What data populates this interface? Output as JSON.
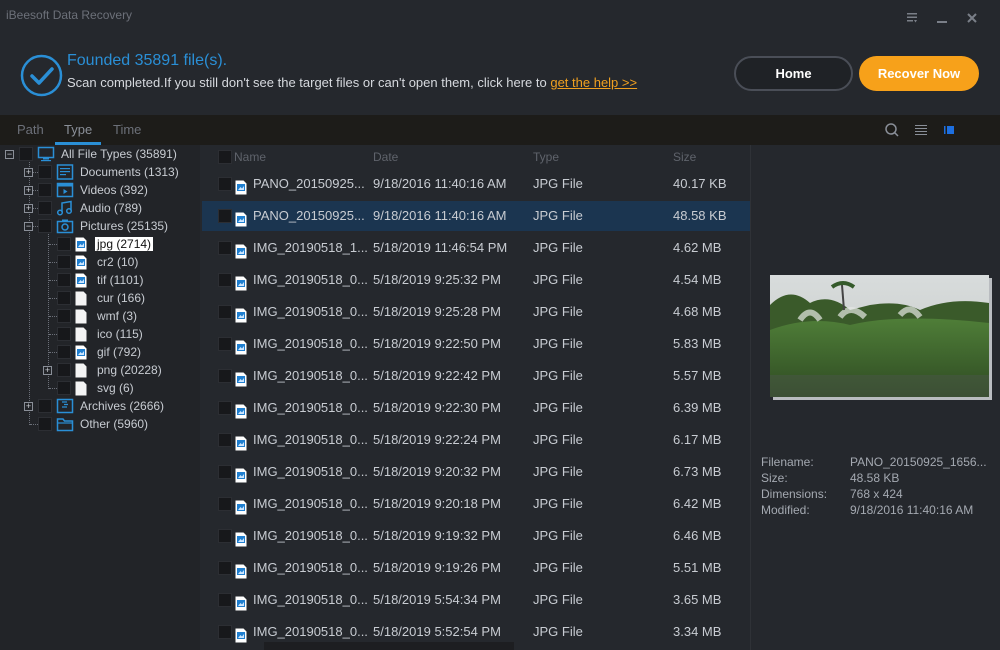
{
  "window": {
    "title": "iBeesoft Data Recovery",
    "controls": [
      "menu-icon",
      "minimize-icon",
      "close-icon"
    ]
  },
  "header": {
    "status_title": "Founded 35891 file(s).",
    "status_text": "Scan completed.If you still don't see the target files or can't open them, click here to ",
    "help_link": "get the help >>",
    "home_label": "Home",
    "recover_label": "Recover Now",
    "accent": "#2a8fd6",
    "recover_color": "#f7a11a"
  },
  "tabs": [
    {
      "label": "Path",
      "active": false
    },
    {
      "label": "Type",
      "active": true
    },
    {
      "label": "Time",
      "active": false
    }
  ],
  "toolbar_icons": [
    "search-icon",
    "list-view-icon",
    "thumbnail-view-icon"
  ],
  "tree": {
    "root": {
      "label": "All File Types (35891)",
      "expanded": true
    },
    "categories": [
      {
        "label": "Documents (1313)",
        "icon": "document-icon",
        "expanded": false
      },
      {
        "label": "Videos (392)",
        "icon": "video-icon",
        "expanded": false
      },
      {
        "label": "Audio (789)",
        "icon": "audio-icon",
        "expanded": false
      },
      {
        "label": "Pictures (25135)",
        "icon": "camera-icon",
        "expanded": true
      },
      {
        "label": "Archives (2666)",
        "icon": "archive-icon",
        "expanded": false
      },
      {
        "label": "Other (5960)",
        "icon": "folder-icon",
        "expanded": false
      }
    ],
    "pictures_children": [
      {
        "label": "jpg (2714)",
        "image_icon": true,
        "selected": true
      },
      {
        "label": "cr2 (10)",
        "image_icon": true
      },
      {
        "label": "tif (1101)",
        "image_icon": true
      },
      {
        "label": "cur (166)",
        "image_icon": false
      },
      {
        "label": "wmf (3)",
        "image_icon": false
      },
      {
        "label": "ico (115)",
        "image_icon": false
      },
      {
        "label": "gif (792)",
        "image_icon": true
      },
      {
        "label": "png (20228)",
        "image_icon": false,
        "expandable": true
      },
      {
        "label": "svg (6)",
        "image_icon": false
      }
    ]
  },
  "filelist": {
    "columns": {
      "name": "Name",
      "date": "Date",
      "type": "Type",
      "size": "Size"
    },
    "rows": [
      {
        "name": "PANO_20150925...",
        "date": "9/18/2016 11:40:16 AM",
        "type": "JPG File",
        "size": "40.17 KB"
      },
      {
        "name": "PANO_20150925...",
        "date": "9/18/2016 11:40:16 AM",
        "type": "JPG File",
        "size": "48.58 KB",
        "selected": true
      },
      {
        "name": "IMG_20190518_1...",
        "date": "5/18/2019 11:46:54 PM",
        "type": "JPG File",
        "size": "4.62 MB"
      },
      {
        "name": "IMG_20190518_0...",
        "date": "5/18/2019 9:25:32 PM",
        "type": "JPG File",
        "size": "4.54 MB"
      },
      {
        "name": "IMG_20190518_0...",
        "date": "5/18/2019 9:25:28 PM",
        "type": "JPG File",
        "size": "4.68 MB"
      },
      {
        "name": "IMG_20190518_0...",
        "date": "5/18/2019 9:22:50 PM",
        "type": "JPG File",
        "size": "5.83 MB"
      },
      {
        "name": "IMG_20190518_0...",
        "date": "5/18/2019 9:22:42 PM",
        "type": "JPG File",
        "size": "5.57 MB"
      },
      {
        "name": "IMG_20190518_0...",
        "date": "5/18/2019 9:22:30 PM",
        "type": "JPG File",
        "size": "6.39 MB"
      },
      {
        "name": "IMG_20190518_0...",
        "date": "5/18/2019 9:22:24 PM",
        "type": "JPG File",
        "size": "6.17 MB"
      },
      {
        "name": "IMG_20190518_0...",
        "date": "5/18/2019 9:20:32 PM",
        "type": "JPG File",
        "size": "6.73 MB"
      },
      {
        "name": "IMG_20190518_0...",
        "date": "5/18/2019 9:20:18 PM",
        "type": "JPG File",
        "size": "6.42 MB"
      },
      {
        "name": "IMG_20190518_0...",
        "date": "5/18/2019 9:19:32 PM",
        "type": "JPG File",
        "size": "6.46 MB"
      },
      {
        "name": "IMG_20190518_0...",
        "date": "5/18/2019 9:19:26 PM",
        "type": "JPG File",
        "size": "5.51 MB"
      },
      {
        "name": "IMG_20190518_0...",
        "date": "5/18/2019 5:54:34 PM",
        "type": "JPG File",
        "size": "3.65 MB"
      },
      {
        "name": "IMG_20190518_0...",
        "date": "5/18/2019 5:52:54 PM",
        "type": "JPG File",
        "size": "3.34 MB"
      }
    ]
  },
  "preview": {
    "image_desc": "landscape photo of green grass field and trees",
    "labels": {
      "filename": "Filename:",
      "size": "Size:",
      "dimensions": "Dimensions:",
      "modified": "Modified:"
    },
    "filename": "PANO_20150925_1656...",
    "size": "48.58 KB",
    "dimensions": "768 x 424",
    "modified": "9/18/2016 11:40:16 AM"
  }
}
